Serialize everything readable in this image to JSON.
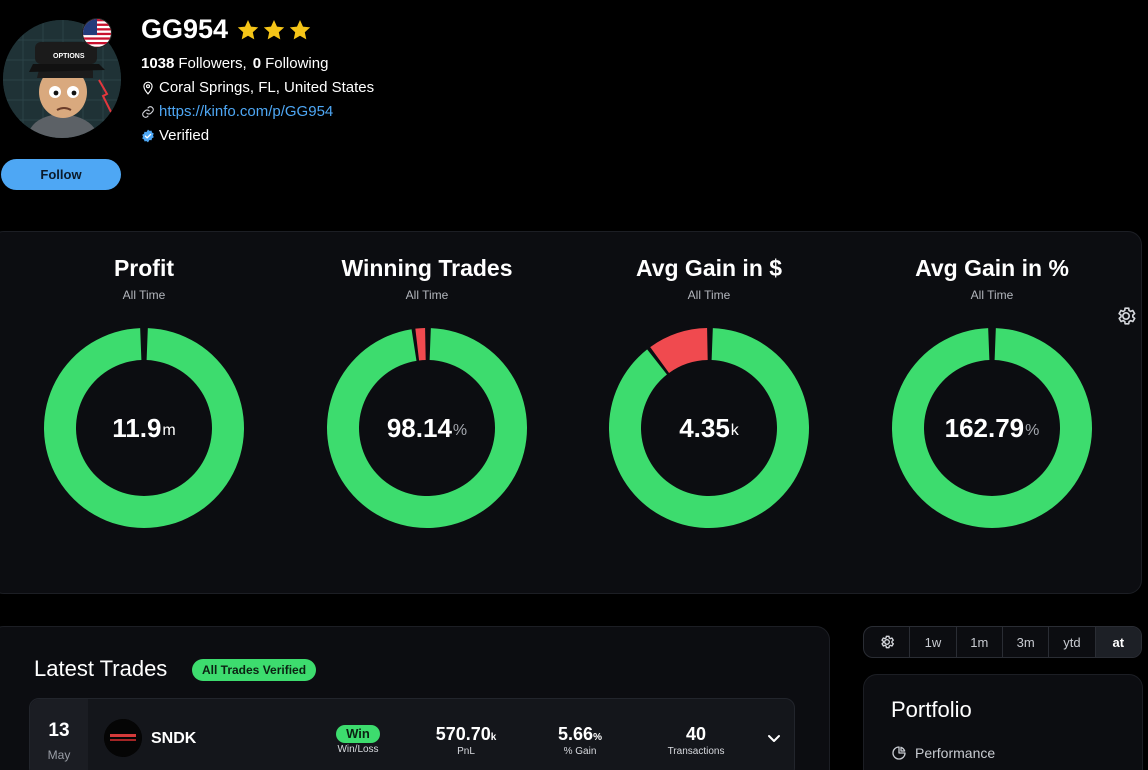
{
  "profile": {
    "username": "GG954",
    "star_count": 3,
    "followers_count": "1038",
    "followers_label": "Followers,",
    "following_count": "0",
    "following_label": "Following",
    "location": "Coral Springs, FL, United States",
    "url": "https://kinfo.com/p/GG954",
    "verified_label": "Verified",
    "follow_label": "Follow",
    "avatar_hat_text": "OPTIONS"
  },
  "stats": [
    {
      "title": "Profit",
      "subtitle": "All Time",
      "value": "11.9",
      "unit": "m",
      "fraction": 0.0,
      "display": "full"
    },
    {
      "title": "Winning Trades",
      "subtitle": "All Time",
      "value": "98.14",
      "unit": "%",
      "fraction": 0.9814
    },
    {
      "title": "Avg Gain in $",
      "subtitle": "All Time",
      "value": "4.35",
      "unit": "k",
      "fraction": 0.9
    },
    {
      "title": "Avg Gain in %",
      "subtitle": "All Time",
      "value": "162.79",
      "unit": "%",
      "fraction": 1.0
    }
  ],
  "latest_trades": {
    "title": "Latest Trades",
    "badge": "All Trades Verified",
    "rows": [
      {
        "day": "13",
        "month": "May",
        "ticker": "SNDK",
        "result": "Win",
        "result_label": "Win/Loss",
        "pnl": "570.70",
        "pnl_unit": "k",
        "pnl_label": "PnL",
        "gain": "5.66",
        "gain_unit": "%",
        "gain_label": "% Gain",
        "transactions": "40",
        "transactions_label": "Transactions"
      }
    ]
  },
  "range_tabs": [
    "1w",
    "1m",
    "3m",
    "ytd",
    "at"
  ],
  "range_active": "at",
  "portfolio": {
    "title": "Portfolio",
    "performance_label": "Performance"
  },
  "colors": {
    "green": "#3ddc6e",
    "red": "#f04a4f",
    "accent_blue": "#4ea7f4",
    "star_yellow": "#f5c518",
    "background": "#000000",
    "card": "#0c0d11"
  }
}
